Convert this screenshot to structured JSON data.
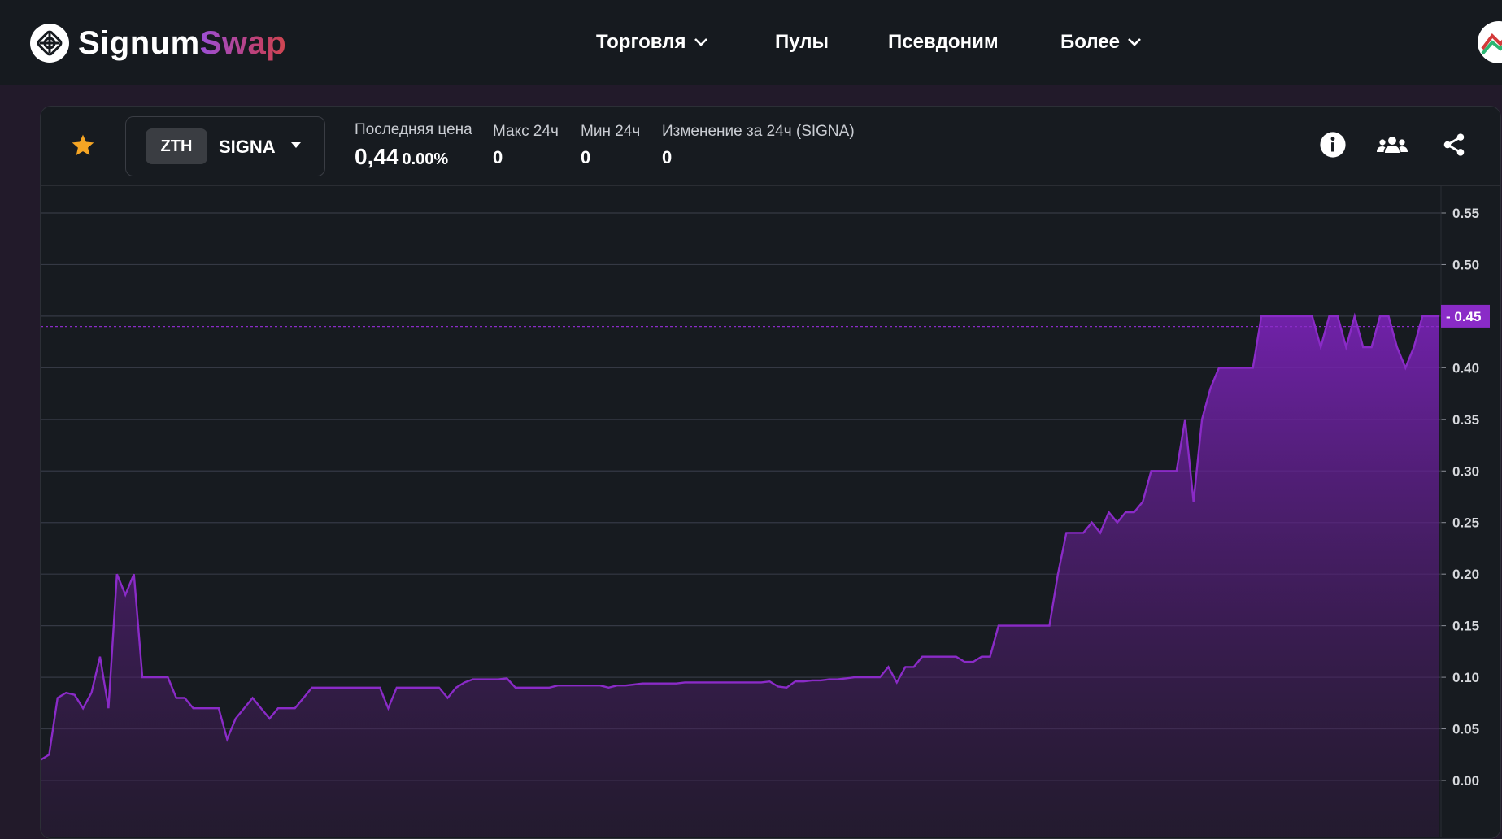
{
  "app": {
    "logo_part1": "Signum",
    "logo_part2": "Swap",
    "logo_icon": "signum-logo-icon",
    "brand_color": "#8a2bc7"
  },
  "nav": {
    "items": [
      {
        "label": "Торговля",
        "has_dropdown": true
      },
      {
        "label": "Пулы",
        "has_dropdown": false
      },
      {
        "label": "Псевдоним",
        "has_dropdown": false
      },
      {
        "label": "Более",
        "has_dropdown": true
      }
    ],
    "avatar_icon": "wallet-avatar-icon"
  },
  "market": {
    "base": "ZTH",
    "quote": "SIGNA",
    "favorite_icon": "star-icon",
    "last_price_label": "Последняя цена",
    "last_price": "0,44",
    "last_price_change": "0.00%",
    "high_label": "Макс 24ч",
    "high": "0",
    "low_label": "Мин 24ч",
    "low": "0",
    "change_label": "Изменение за 24ч (SIGNA)",
    "change": "0",
    "icons": [
      "info-icon",
      "users-icon",
      "share-icon"
    ]
  },
  "chart_data": {
    "type": "area",
    "title": "",
    "xlabel": "",
    "ylabel": "",
    "ylim": [
      0,
      0.55
    ],
    "y_ticks": [
      "0.00",
      "0.05",
      "0.10",
      "0.15",
      "0.20",
      "0.25",
      "0.30",
      "0.35",
      "0.40",
      "0.45",
      "0.50",
      "0.55"
    ],
    "current_price_label": "0.45",
    "current_price_line": 0.44,
    "line_color": "#8a2bc7",
    "grid": true,
    "series": [
      {
        "values": [
          0.02,
          0.025,
          0.08,
          0.085,
          0.083,
          0.07,
          0.085,
          0.12,
          0.07,
          0.2,
          0.18,
          0.2,
          0.1,
          0.1,
          0.1,
          0.1,
          0.08,
          0.08,
          0.07,
          0.07,
          0.07,
          0.07,
          0.04,
          0.06,
          0.07,
          0.08,
          0.07,
          0.06,
          0.07,
          0.07,
          0.07,
          0.08,
          0.09,
          0.09,
          0.09,
          0.09,
          0.09,
          0.09,
          0.09,
          0.09,
          0.09,
          0.07,
          0.09,
          0.09,
          0.09,
          0.09,
          0.09,
          0.09,
          0.08,
          0.09,
          0.095,
          0.098,
          0.098,
          0.098,
          0.098,
          0.099,
          0.09,
          0.09,
          0.09,
          0.09,
          0.09,
          0.092,
          0.092,
          0.092,
          0.092,
          0.092,
          0.092,
          0.09,
          0.092,
          0.092,
          0.093,
          0.094,
          0.094,
          0.094,
          0.094,
          0.094,
          0.095,
          0.095,
          0.095,
          0.095,
          0.095,
          0.095,
          0.095,
          0.095,
          0.095,
          0.095,
          0.096,
          0.091,
          0.09,
          0.096,
          0.096,
          0.097,
          0.097,
          0.098,
          0.098,
          0.099,
          0.1,
          0.1,
          0.1,
          0.1,
          0.11,
          0.095,
          0.11,
          0.11,
          0.12,
          0.12,
          0.12,
          0.12,
          0.12,
          0.115,
          0.115,
          0.12,
          0.12,
          0.15,
          0.15,
          0.15,
          0.15,
          0.15,
          0.15,
          0.15,
          0.2,
          0.24,
          0.24,
          0.24,
          0.25,
          0.24,
          0.26,
          0.25,
          0.26,
          0.26,
          0.27,
          0.3,
          0.3,
          0.3,
          0.3,
          0.35,
          0.27,
          0.35,
          0.38,
          0.4,
          0.4,
          0.4,
          0.4,
          0.4,
          0.45,
          0.45,
          0.45,
          0.45,
          0.45,
          0.45,
          0.45,
          0.42,
          0.45,
          0.45,
          0.42,
          0.45,
          0.42,
          0.42,
          0.45,
          0.45,
          0.42,
          0.4,
          0.42,
          0.45,
          0.45,
          0.45
        ]
      }
    ]
  }
}
